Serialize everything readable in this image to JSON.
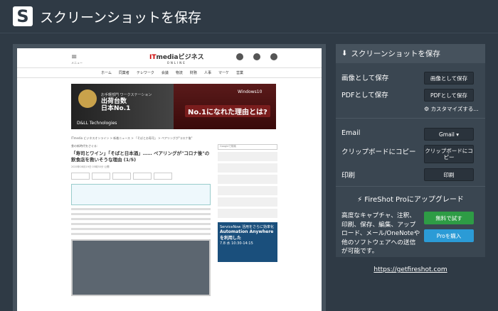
{
  "app": {
    "title": "スクリーンショットを保存",
    "logo": "S"
  },
  "preview": {
    "site_menu": "≡",
    "site_menu_label": "メニュー",
    "site_brand_a": "IT",
    "site_brand_b": "mediaビジネス",
    "site_brand_c": "ONLINE",
    "nav": [
      "ホーム",
      "同業者",
      "テレワーク",
      "会議",
      "物流",
      "財務",
      "人事",
      "マーケ",
      "営業"
    ],
    "ad_line1": "お手軽部門 ワークステーション",
    "ad_line2": "出荷台数\n日本No.1",
    "ad_dell": "D&LL Technologies",
    "ad_badge": "No.1になれた理由とは?",
    "ad_windows": "Windows10",
    "breadcrumb": "ITmedia ビジネスオンライン > 新着ニュース > 「そばとお寿司」 > ペアリングが\"コロナ後\"",
    "article_cat": "食の新時代をさぐる:",
    "article_title": "「寿司とワイン」「そばと日本酒」…… ペアリングが\"コロナ後\"の飲食店を救いそうな理由 (1/5)",
    "article_meta": "2020年08月19日 05時30分 公開",
    "search_placeholder": "Googleで検索",
    "ad2_head": "ServiceNow 活用をさらに効率化",
    "ad2_big": "Automation Anywhere を利用した",
    "ad2_foot": "7.8 水 10:30-14:15"
  },
  "panel": {
    "header": "スクリーンショットを保存",
    "save_image_label": "画像として保存",
    "save_image_btn": "画像として保存",
    "save_pdf_label": "PDFとして保存",
    "save_pdf_btn": "PDFとして保存",
    "customize": "カスタマイズする...",
    "email_label": "Email",
    "email_btn": "Gmail ▾",
    "clipboard_label": "クリップボードにコピー",
    "clipboard_btn": "クリップボードにコピー",
    "print_label": "印刷",
    "print_btn": "印刷",
    "upgrade": "FireShot Proにアップグレード",
    "upgrade_desc": "高度なキャプチャ、注釈、印刷、保存、編集、アップロード、メール/OneNoteや他のソフトウェアへの送信が可能です。",
    "trial_btn": "無料で試す",
    "buy_btn": "Proを購入",
    "link": "https://getfireshot.com"
  }
}
